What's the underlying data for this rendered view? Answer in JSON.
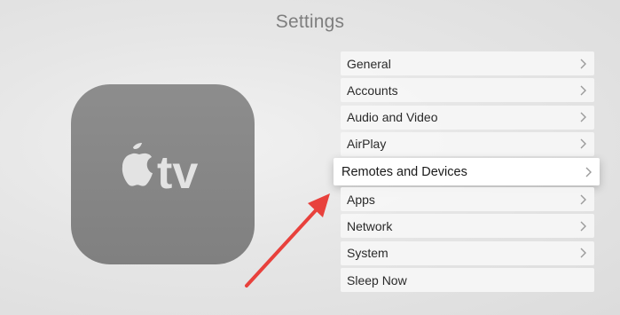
{
  "screen": {
    "title": "Settings"
  },
  "device_icon": {
    "logo_text": "tv",
    "icon": "apple-logo-icon"
  },
  "menu": {
    "items": [
      {
        "label": "General",
        "has_chevron": true,
        "focused": false
      },
      {
        "label": "Accounts",
        "has_chevron": true,
        "focused": false
      },
      {
        "label": "Audio and Video",
        "has_chevron": true,
        "focused": false
      },
      {
        "label": "AirPlay",
        "has_chevron": true,
        "focused": false
      },
      {
        "label": "Remotes and Devices",
        "has_chevron": true,
        "focused": true
      },
      {
        "label": "Apps",
        "has_chevron": true,
        "focused": false
      },
      {
        "label": "Network",
        "has_chevron": true,
        "focused": false
      },
      {
        "label": "System",
        "has_chevron": true,
        "focused": false
      },
      {
        "label": "Sleep Now",
        "has_chevron": false,
        "focused": false
      }
    ]
  },
  "annotation": {
    "color": "#e8413c",
    "points_to": "Remotes and Devices"
  }
}
